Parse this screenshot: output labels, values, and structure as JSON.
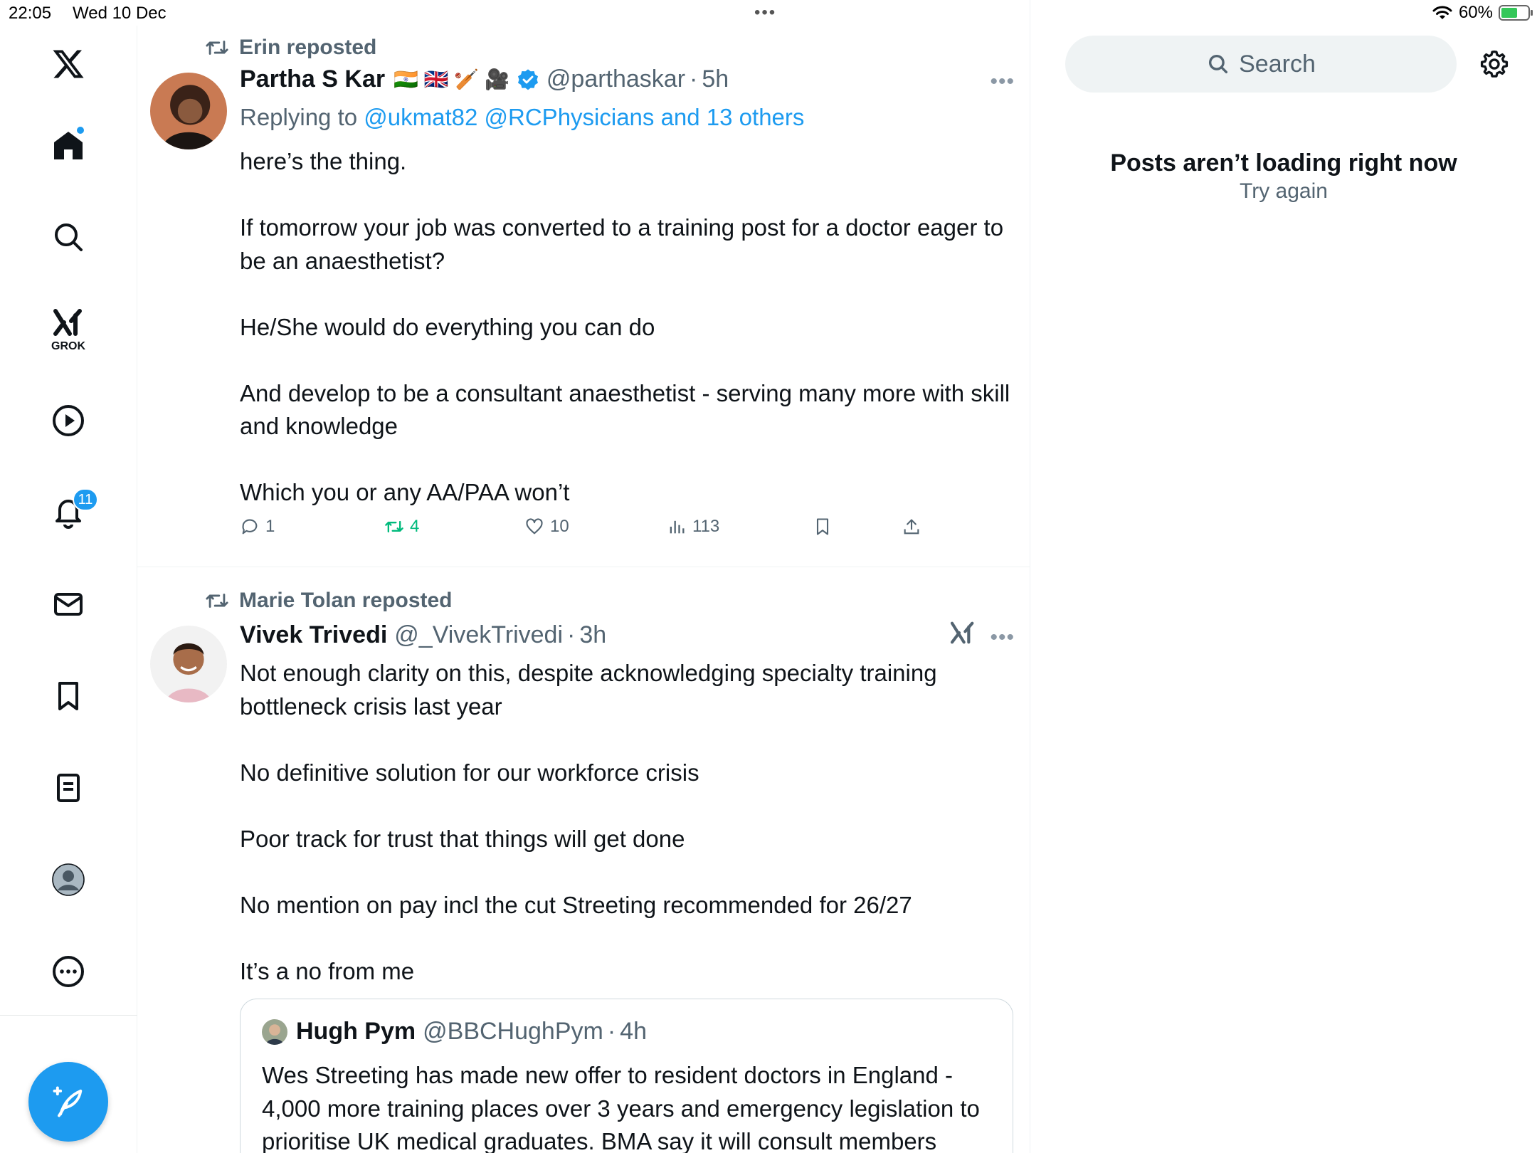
{
  "status_bar": {
    "time": "22:05",
    "date": "Wed 10 Dec",
    "battery": "60%"
  },
  "nav": {
    "notifications_badge": "11",
    "grok_label": "GROK"
  },
  "posts": [
    {
      "reposted_by": "Erin reposted",
      "author": "Partha S Kar",
      "flags": "🇮🇳 🇬🇧 🏏 🎥",
      "handle": "@parthaskar",
      "time": "5h",
      "reply_prefix": "Replying to",
      "reply_targets": "@ukmat82 @RCPhysicians and 13 others",
      "body": [
        "here’s the thing.",
        "If tomorrow your job was converted to a training post for a doctor eager to be an anaesthetist?",
        "He/She would do everything you can do",
        "And develop to be a consultant anaesthetist - serving many more with skill and knowledge",
        "Which you or any AA/PAA won’t"
      ],
      "replies": "1",
      "reposts": "4",
      "likes": "10",
      "views": "113"
    },
    {
      "reposted_by": "Marie Tolan reposted",
      "author": "Vivek Trivedi",
      "handle": "@_VivekTrivedi",
      "time": "3h",
      "body": [
        "Not enough clarity on this, despite acknowledging specialty training bottleneck crisis last year",
        "No definitive solution for our workforce crisis",
        "Poor track for trust that things will get done",
        "No mention on pay incl the cut Streeting recommended for 26/27",
        "It’s a no from me"
      ],
      "quote": {
        "author": "Hugh Pym",
        "handle": "@BBCHughPym",
        "time": "4h",
        "text": "Wes Streeting has made new offer to resident doctors in England - 4,000 more training places over 3 years and emergency legislation to prioritise UK medical graduates. BMA say it will consult members"
      }
    }
  ],
  "sidebar": {
    "search_placeholder": "Search",
    "error_title": "Posts aren’t loading right now",
    "retry_label": "Try again"
  },
  "colors": {
    "accent": "#1d9bf0",
    "repost_green": "#00ba7c",
    "muted": "#536471"
  }
}
